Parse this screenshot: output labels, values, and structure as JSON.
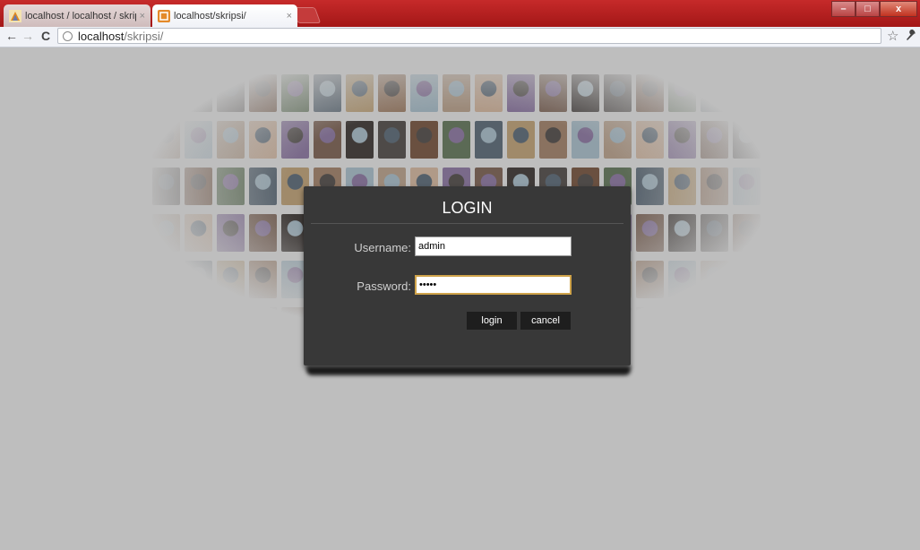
{
  "browser": {
    "tabs": [
      {
        "title": "localhost / localhost / skrip",
        "close": "×"
      },
      {
        "title": "localhost/skripsi/",
        "close": "×"
      }
    ],
    "window_controls": {
      "minimize": "–",
      "maximize": "□",
      "close": "x"
    },
    "nav": {
      "back": "←",
      "forward": "→",
      "reload": "C"
    },
    "address": {
      "host": "localhost",
      "path": "/skripsi/"
    },
    "star": "☆",
    "wrench": "🔧"
  },
  "login": {
    "title": "LOGIN",
    "username_label": "Username:",
    "username_value": "admin",
    "password_label": "Password:",
    "password_value": "•••••",
    "login_button": "login",
    "cancel_button": "cancel"
  },
  "colors": {
    "titlebar": "#b21f1f",
    "page_background": "#bebebe",
    "dialog": "#383838",
    "button": "#1e1e1e",
    "focus_border": "#cfa34a"
  }
}
